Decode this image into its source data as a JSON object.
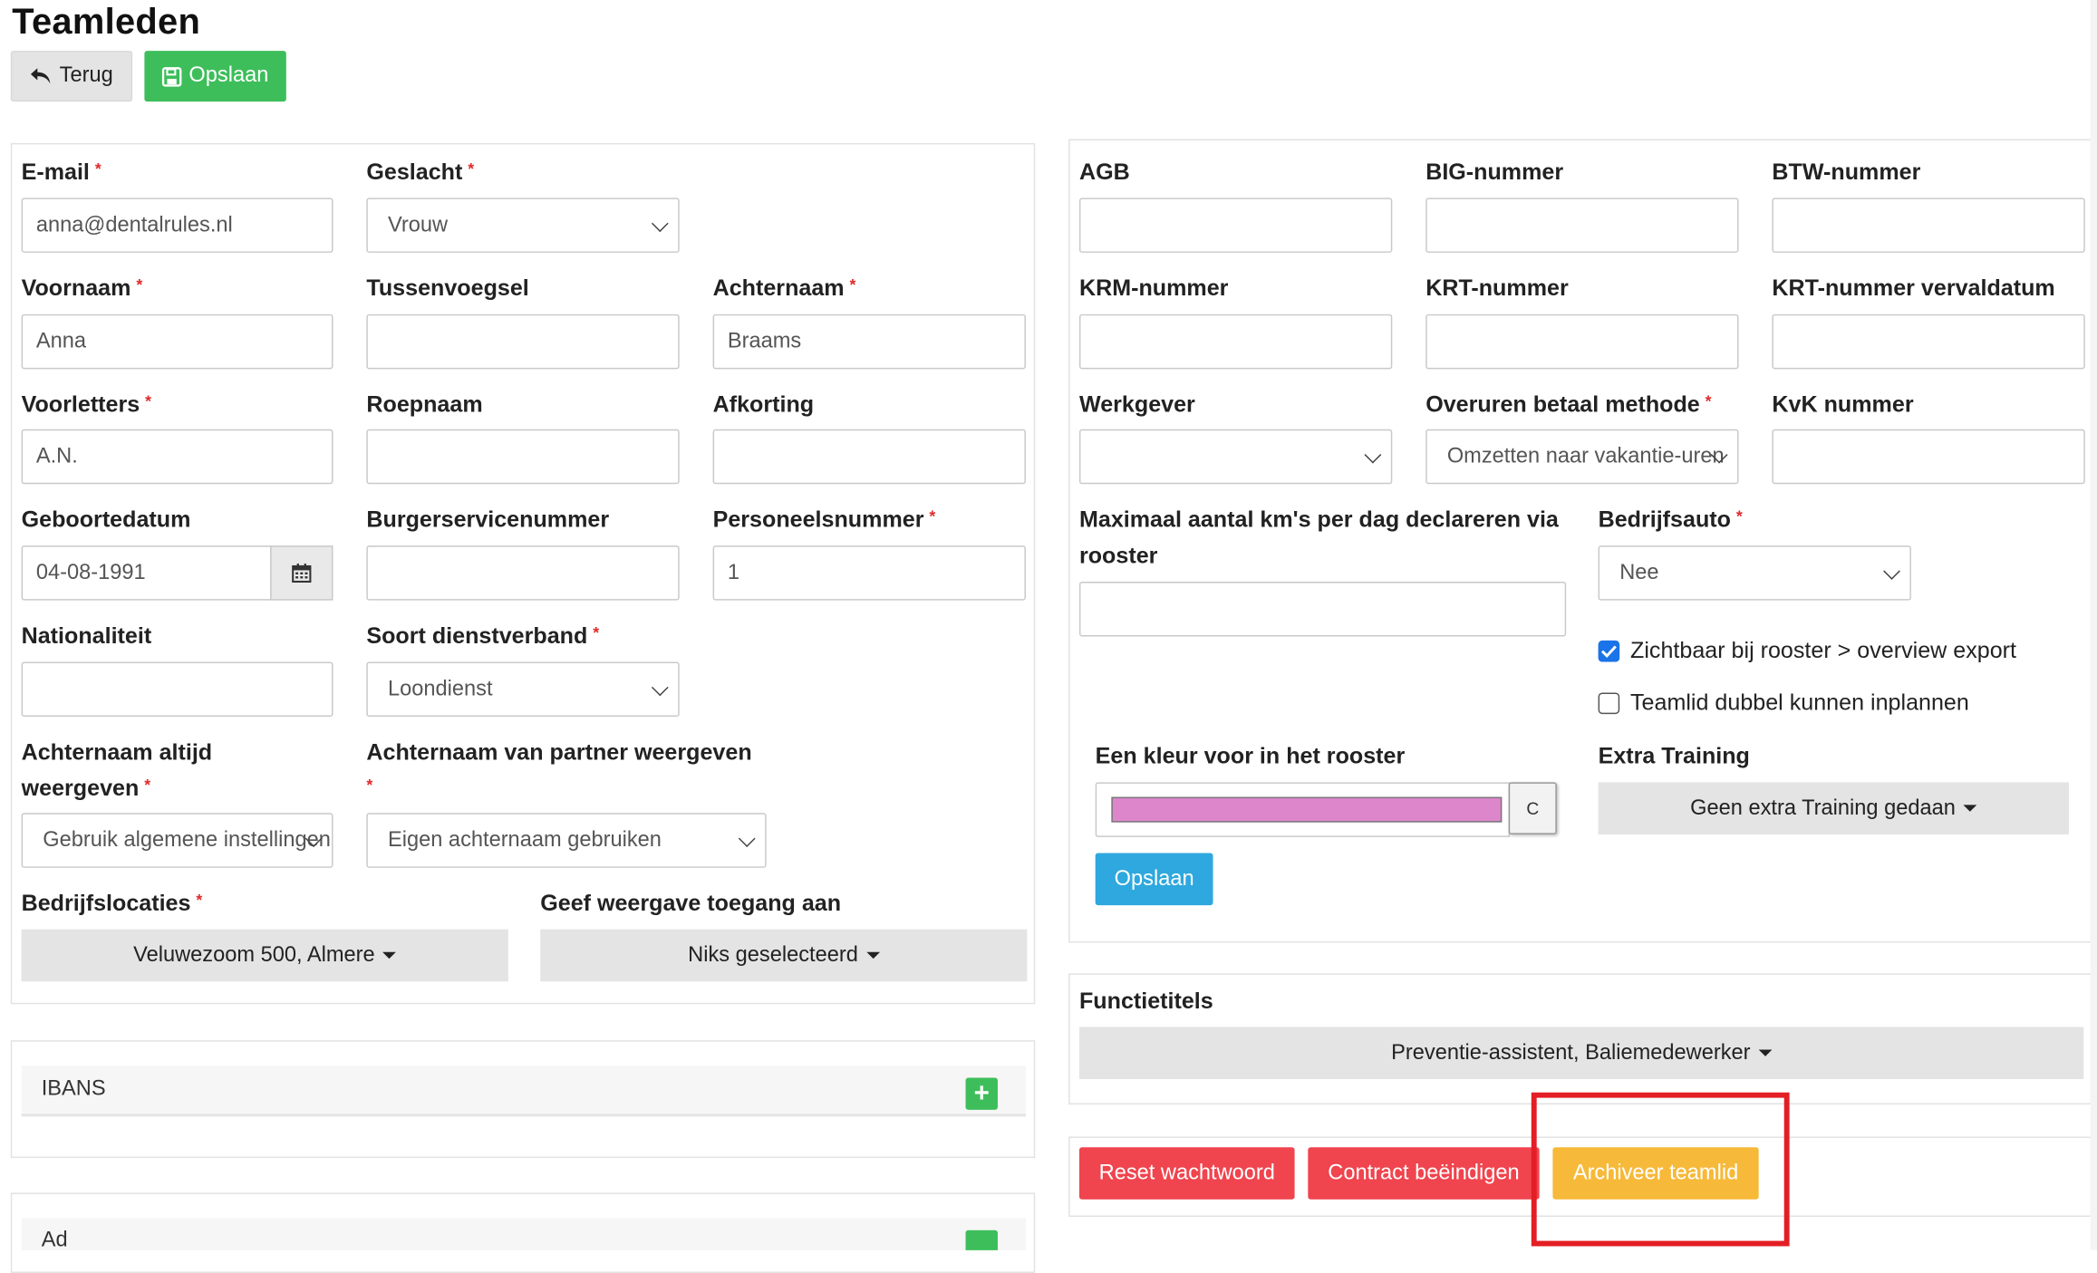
{
  "page": {
    "title": "Teamleden"
  },
  "toolbar": {
    "back_label": "Terug",
    "save_label": "Opslaan"
  },
  "left": {
    "email": {
      "label": "E-mail",
      "value": "anna@dentalrules.nl"
    },
    "gender": {
      "label": "Geslacht",
      "value": "Vrouw"
    },
    "first_name": {
      "label": "Voornaam",
      "value": "Anna"
    },
    "infix": {
      "label": "Tussenvoegsel",
      "value": ""
    },
    "last_name": {
      "label": "Achternaam",
      "value": "Braams"
    },
    "initials": {
      "label": "Voorletters",
      "value": "A.N."
    },
    "nickname": {
      "label": "Roepnaam",
      "value": ""
    },
    "abbreviation": {
      "label": "Afkorting",
      "value": ""
    },
    "birthdate": {
      "label": "Geboortedatum",
      "value": "04-08-1991"
    },
    "bsn": {
      "label": "Burgerservicenummer",
      "value": ""
    },
    "staff_number": {
      "label": "Personeelsnummer",
      "value": "1"
    },
    "nationality": {
      "label": "Nationaliteit",
      "value": ""
    },
    "employment_type": {
      "label": "Soort dienstverband",
      "value": "Loondienst"
    },
    "always_last_name": {
      "label_line1": "Achternaam altijd",
      "label_line2": "weergeven",
      "value": "Gebruik algemene instellingen"
    },
    "partner_last_name": {
      "label": "Achternaam van partner weergeven",
      "value": "Eigen achternaam gebruiken"
    },
    "locations": {
      "label": "Bedrijfslocaties",
      "value": "Veluwezoom 500, Almere"
    },
    "view_access": {
      "label": "Geef weergave toegang aan",
      "value": "Niks geselecteerd"
    }
  },
  "ibans": {
    "label": "IBANS",
    "add": "+"
  },
  "second_section": {
    "label": "Ad",
    "add": "+"
  },
  "right": {
    "agb": {
      "label": "AGB",
      "value": ""
    },
    "big": {
      "label": "BIG-nummer",
      "value": ""
    },
    "btw": {
      "label": "BTW-nummer",
      "value": ""
    },
    "krm": {
      "label": "KRM-nummer",
      "value": ""
    },
    "krt": {
      "label": "KRT-nummer",
      "value": ""
    },
    "krt_expiry": {
      "label": "KRT-nummer vervaldatum",
      "value": ""
    },
    "employer": {
      "label": "Werkgever",
      "value": ""
    },
    "overtime_method": {
      "label": "Overuren betaal methode",
      "value": "Omzetten naar vakantie-uren"
    },
    "kvk": {
      "label": "KvK nummer",
      "value": ""
    },
    "max_km": {
      "label_line1": "Maximaal aantal km's per dag declareren via",
      "label_line2": "rooster",
      "value": ""
    },
    "company_car": {
      "label": "Bedrijfsauto",
      "value": "Nee"
    },
    "visible_export": {
      "label": "Zichtbaar bij rooster > overview export",
      "checked": true
    },
    "double_plan": {
      "label": "Teamlid dubbel kunnen inplannen",
      "checked": false
    },
    "color": {
      "label": "Een kleur voor in het rooster",
      "value": "#de86cc",
      "button": "C"
    },
    "save_label": "Opslaan",
    "extra_training": {
      "label": "Extra Training",
      "value": "Geen extra Training gedaan"
    }
  },
  "function_titles": {
    "label": "Functietitels",
    "value": "Preventie-assistent, Baliemedewerker"
  },
  "actions": {
    "reset_password": "Reset wachtwoord",
    "end_contract": "Contract beëindigen",
    "archive": "Archiveer teamlid"
  },
  "colors": {
    "green": "#3dbe5a",
    "blue": "#2ea8de",
    "red": "#f0444e",
    "orange": "#f7b939",
    "highlight": "#e31e24"
  }
}
